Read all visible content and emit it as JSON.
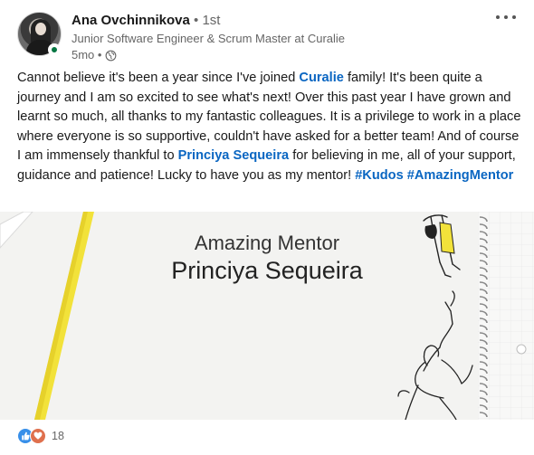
{
  "author": {
    "name": "Ana Ovchinnikova",
    "degree": "• 1st",
    "headline": "Junior Software Engineer & Scrum Master at Curalie",
    "time": "5mo •",
    "visibility_icon": "globe-icon"
  },
  "post": {
    "text_part1": "Cannot believe it's been a year since I've joined ",
    "company_link": "Curalie",
    "text_part2": " family! It's been quite a journey and I am so excited to see what's next! Over this past year I have grown and learnt so much, all thanks to my fantastic colleagues. It is a privilege to work in a place where everyone is so supportive, couldn't have asked for a better team! And of course I am immensely thankful to ",
    "mention_link": "Princiya Sequeira",
    "text_part3": " for believing in me, all of your support, guidance and patience! Lucky to have you as my mentor! ",
    "hashtag1": "#Kudos",
    "hashtag2": "#AmazingMentor"
  },
  "image": {
    "line1": "Amazing Mentor",
    "line2": "Princiya Sequeira"
  },
  "social": {
    "reaction_icons": [
      "like-icon",
      "love-icon"
    ],
    "reaction_count": "18"
  },
  "colors": {
    "link": "#0a66c2",
    "like": "#378fe9",
    "love": "#df704d",
    "online": "#057642",
    "pencil": "#f2e23a"
  }
}
